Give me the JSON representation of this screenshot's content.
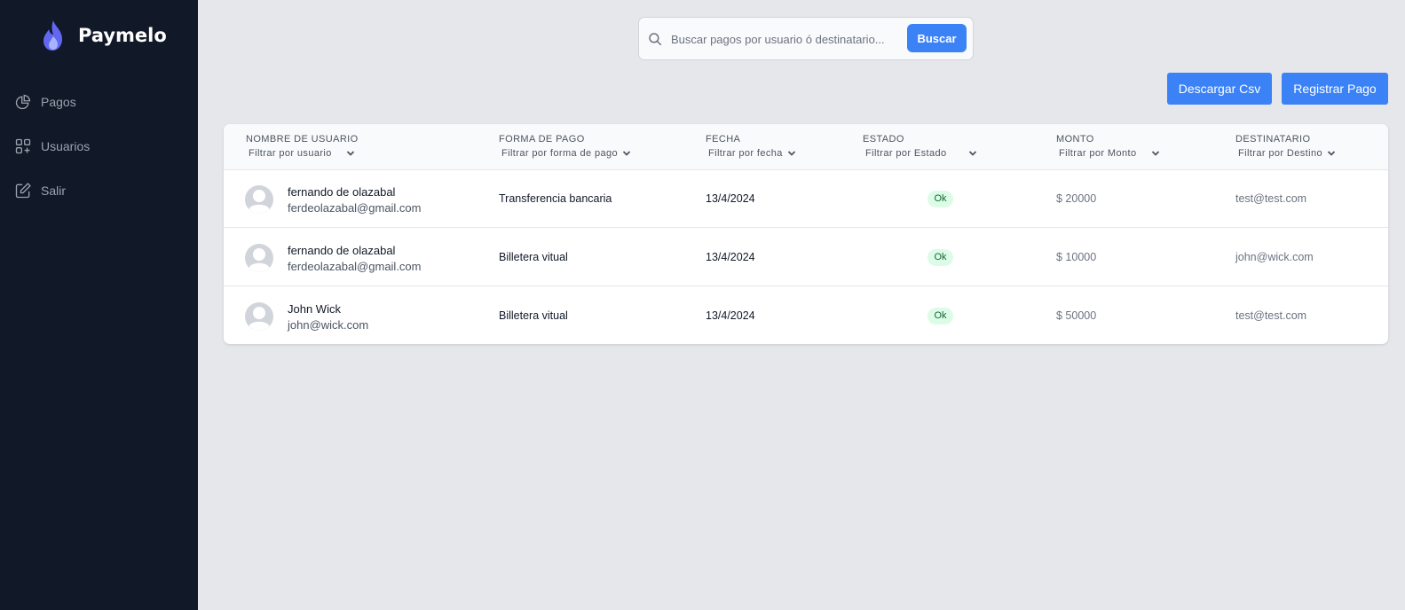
{
  "brand": {
    "name": "Paymelo",
    "logo": "flame-icon"
  },
  "sidebar": {
    "items": [
      {
        "label": "Pagos",
        "icon": "pie-chart-icon"
      },
      {
        "label": "Usuarios",
        "icon": "squares-plus-icon"
      },
      {
        "label": "Salir",
        "icon": "edit-icon"
      }
    ]
  },
  "search": {
    "placeholder": "Buscar pagos por usuario ó destinatario...",
    "button_label": "Buscar"
  },
  "actions": {
    "download_csv": "Descargar Csv",
    "register_payment": "Registrar Pago"
  },
  "table": {
    "columns": [
      {
        "title": "NOMBRE DE USUARIO",
        "filter": "Filtrar por usuario"
      },
      {
        "title": "FORMA DE PAGO",
        "filter": "Filtrar por forma de pago"
      },
      {
        "title": "FECHA",
        "filter": "Filtrar por fecha"
      },
      {
        "title": "ESTADO",
        "filter": "Filtrar por Estado"
      },
      {
        "title": "MONTO",
        "filter": "Filtrar por Monto"
      },
      {
        "title": "DESTINATARIO",
        "filter": "Filtrar por Destino"
      }
    ],
    "rows": [
      {
        "name": "fernando de olazabal",
        "email": "ferdeolazabal@gmail.com",
        "method": "Transferencia bancaria",
        "date": "13/4/2024",
        "status": "Ok",
        "amount": "$ 20000",
        "recipient": "test@test.com"
      },
      {
        "name": "fernando de olazabal",
        "email": "ferdeolazabal@gmail.com",
        "method": "Billetera vitual",
        "date": "13/4/2024",
        "status": "Ok",
        "amount": "$ 10000",
        "recipient": "john@wick.com"
      },
      {
        "name": "John Wick",
        "email": "john@wick.com",
        "method": "Billetera vitual",
        "date": "13/4/2024",
        "status": "Ok",
        "amount": "$ 50000",
        "recipient": "test@test.com"
      }
    ]
  },
  "colors": {
    "sidebar_bg": "#111827",
    "page_bg": "#e5e7eb",
    "accent": "#3b82f6",
    "badge_bg": "#dcfce7",
    "badge_text": "#166534"
  }
}
